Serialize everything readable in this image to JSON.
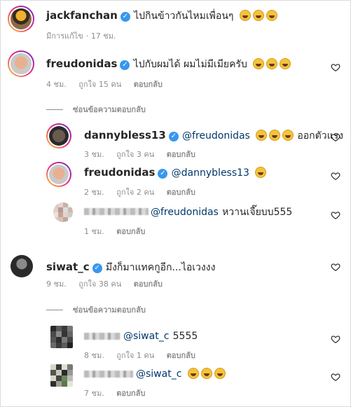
{
  "comments": [
    {
      "username": "jackfanchan",
      "text": "ไปกินข้าวกันไหมเพื่อนๆ",
      "emoji": [
        "laughing-face-emoji",
        "laughing-face-emoji",
        "laughing-face-emoji"
      ],
      "edited": "มีการแก้ไข",
      "time": "17 ชม."
    },
    {
      "username": "freudonidas",
      "text": "ไปกับผมได้ ผมไม่มีเมียครับ",
      "emoji": [
        "grinning-face-emoji",
        "grinning-face-emoji",
        "grinning-face-emoji"
      ],
      "time": "4 ชม.",
      "likes": "ถูกใจ 15 คน",
      "reply": "ตอบกลับ",
      "hide_replies": "ซ่อนข้อความตอบกลับ",
      "replies": [
        {
          "username": "dannybless13",
          "mention": "@freudonidas",
          "text": "ออกตัวแรง",
          "emoji": [
            "grinning-face-emoji",
            "grinning-face-emoji",
            "grinning-face-emoji"
          ],
          "time": "3 ชม.",
          "likes": "ถูกใจ 3 คน",
          "reply": "ตอบกลับ"
        },
        {
          "username": "freudonidas",
          "mention": "@dannybless13",
          "text": "",
          "emoji": [
            "grinning-face-emoji"
          ],
          "time": "2 ชม.",
          "likes": "ถูกใจ 2 คน",
          "reply": "ตอบกลับ"
        },
        {
          "mention": "@freudonidas",
          "text": "หวานเจี๊ยบบ555",
          "time": "1 ชม.",
          "reply": "ตอบกลับ"
        }
      ]
    },
    {
      "username": "siwat_c",
      "text": "มึงก็มาแทคกูอีก...ไอเวงงง",
      "time": "9 ชม.",
      "likes": "ถูกใจ 38 คน",
      "reply": "ตอบกลับ",
      "hide_replies": "ซ่อนข้อความตอบกลับ",
      "replies": [
        {
          "mention": "@siwat_c",
          "text": "5555",
          "time": "8 ชม.",
          "likes": "ถูกใจ 1 คน",
          "reply": "ตอบกลับ"
        },
        {
          "mention": "@siwat_c",
          "text": "",
          "emoji": [
            "grinning-face-emoji",
            "grinning-face-emoji",
            "grinning-face-emoji"
          ],
          "time": "7 ชม.",
          "reply": "ตอบกลับ"
        }
      ]
    }
  ],
  "colors": {
    "verified": "#3897f0",
    "mention": "#00376b",
    "meta": "#8e8e8e",
    "text": "#262626"
  }
}
